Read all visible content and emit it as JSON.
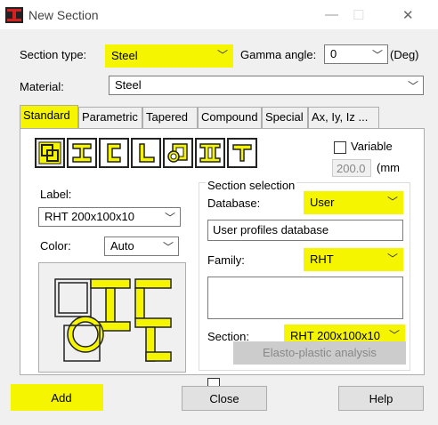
{
  "window": {
    "title": "New Section",
    "minimize_glyph": "—",
    "maximize_glyph": "☐",
    "close_glyph": "✕",
    "app_icon": "i-beam-icon"
  },
  "section_type": {
    "label": "Section type:",
    "value": "Steel"
  },
  "gamma": {
    "label": "Gamma angle:",
    "value": "0",
    "unit": "(Deg)"
  },
  "material": {
    "label": "Material:",
    "value": "Steel"
  },
  "tabs": [
    {
      "label": "Standard",
      "active": true
    },
    {
      "label": "Parametric"
    },
    {
      "label": "Tapered"
    },
    {
      "label": "Compound"
    },
    {
      "label": "Special"
    },
    {
      "label": "Ax, Iy, Iz ..."
    }
  ],
  "shape_buttons": [
    "composite-shape-icon",
    "i-shape-icon",
    "channel-shape-icon",
    "angle-shape-icon",
    "tube-shape-icon",
    "double-i-shape-icon",
    "tee-shape-icon"
  ],
  "variable": {
    "label": "Variable",
    "checked": false,
    "value": "200.0",
    "unit": "(mm"
  },
  "label_field": {
    "label": "Label:",
    "value": "RHT 200x100x10"
  },
  "color_field": {
    "label": "Color:",
    "value": "Auto"
  },
  "section_selection": {
    "title": "Section selection",
    "database_label": "Database:",
    "database_value": "User",
    "database_desc": "User profiles database",
    "family_label": "Family:",
    "family_value": "RHT",
    "section_label": "Section:",
    "section_value": "RHT 200x100x10"
  },
  "elasto_plastic": {
    "label": "Elasto-plastic analysis",
    "checked": false
  },
  "buttons": {
    "add": "Add",
    "close": "Close",
    "help": "Help"
  },
  "colors": {
    "highlight": "#f5f500",
    "dialog_bg": "#f0f0f0"
  }
}
